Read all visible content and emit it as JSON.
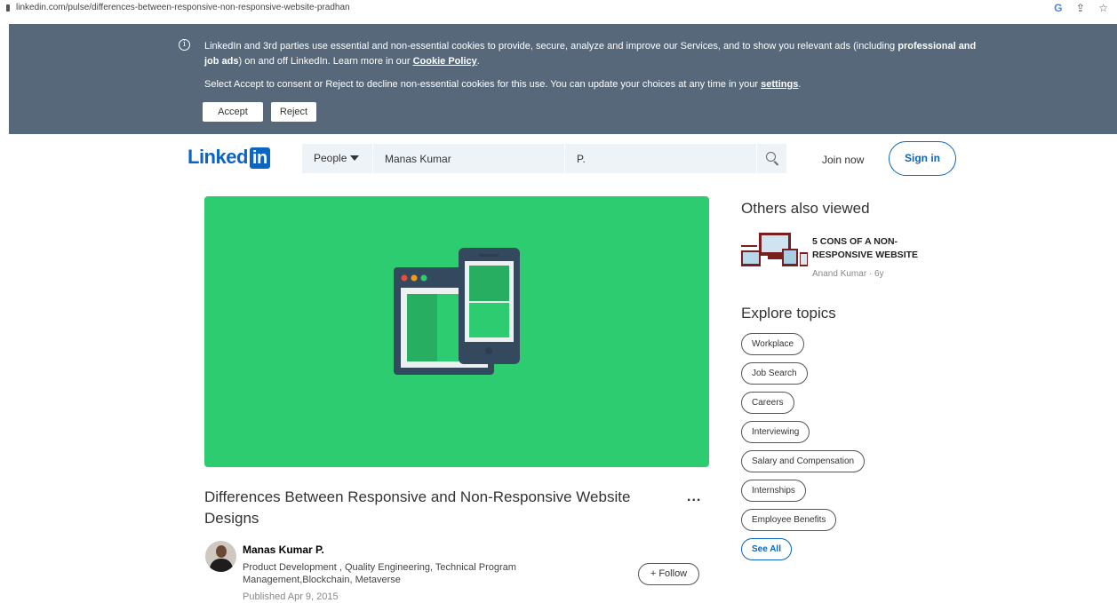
{
  "browser": {
    "url": "linkedin.com/pulse/differences-between-responsive-non-responsive-website-pradhan",
    "google_label": "G"
  },
  "cookie_banner": {
    "text_part1": "LinkedIn and 3rd parties use essential and non-essential cookies to provide, secure, analyze and improve our Services, and to show you relevant ads (including ",
    "text_bold": "professional and job ads",
    "text_part2": ") on and off LinkedIn. Learn more in our ",
    "cookie_policy_link": "Cookie Policy",
    "text_part3": ".",
    "consent_text": "Select Accept to consent or Reject to decline non-essential cookies for this use. You can update your choices at any time in your ",
    "settings_link": "settings",
    "consent_end": ".",
    "accept_label": "Accept",
    "reject_label": "Reject"
  },
  "header": {
    "logo_text": "Linked",
    "logo_in": "in",
    "search_scope": "People",
    "first_name": "Manas Kumar",
    "last_name": "P.",
    "join_label": "Join now",
    "signin_label": "Sign in"
  },
  "article": {
    "title": "Differences Between Responsive and Non-Responsive Website Designs",
    "more_label": "...",
    "author_name": "Manas Kumar P.",
    "author_headline": "Product Development , Quality Engineering, Technical Program Management,Blockchain, Metaverse",
    "published": "Published Apr 9, 2015",
    "follow_label": "+ Follow"
  },
  "sidebar": {
    "others_heading": "Others also viewed",
    "others_item": {
      "title": "5 CONS OF A NON-RESPONSIVE WEBSITE",
      "meta": "Anand Kumar · 6y"
    },
    "explore_heading": "Explore topics",
    "topics": [
      "Workplace",
      "Job Search",
      "Careers",
      "Interviewing",
      "Salary and Compensation",
      "Internships",
      "Employee Benefits"
    ],
    "see_all_label": "See All"
  },
  "colors": {
    "brand_blue": "#0a66c2",
    "banner_bg": "#56687a",
    "hero_green": "#2ecc71"
  }
}
